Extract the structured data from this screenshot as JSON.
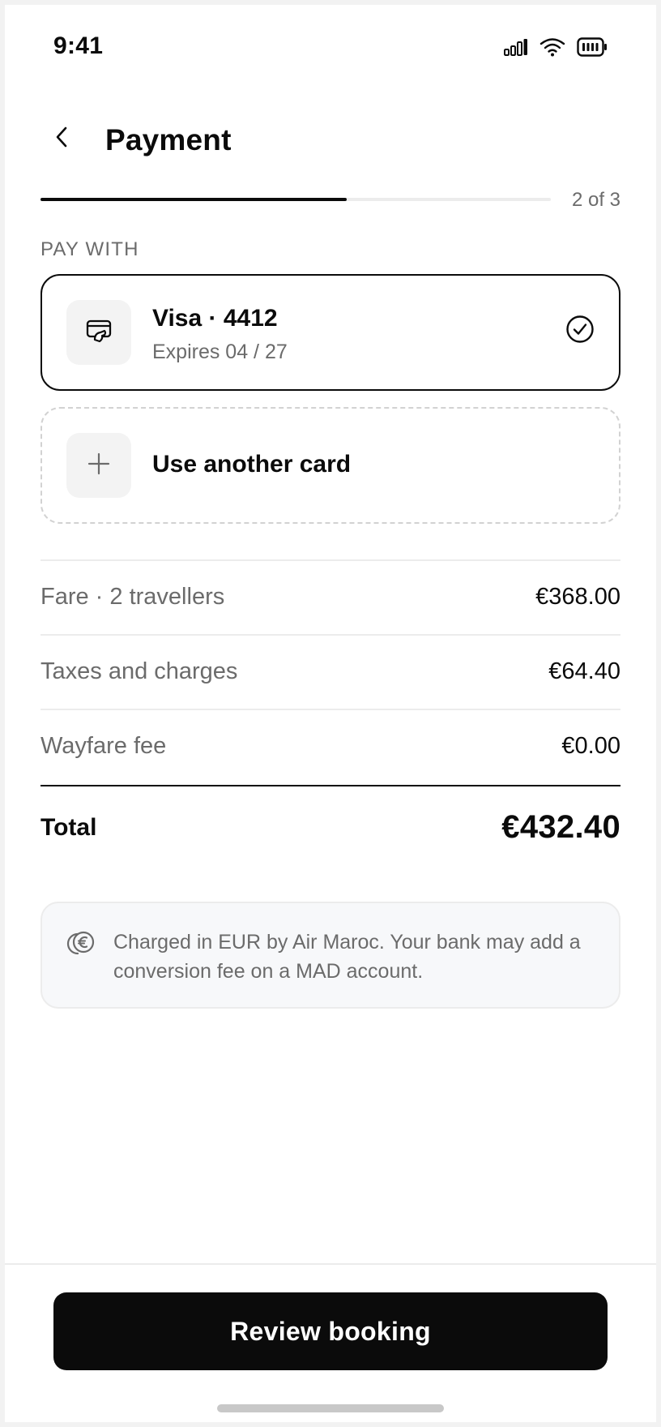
{
  "status_bar": {
    "time": "9:41",
    "icons": [
      "signal-icon",
      "wifi-icon",
      "battery-icon"
    ]
  },
  "header": {
    "back_icon": "chevron-left-icon",
    "title": "Payment"
  },
  "progress": {
    "current_step": 2,
    "total_steps": 3,
    "fraction": 0.6,
    "label": "2 of 3"
  },
  "pay_with": {
    "section_label": "PAY WITH",
    "selected_card": {
      "icon": "card-icon",
      "title": "Visa · 4412",
      "subtitle": "Expires 04 / 27",
      "status_icon": "check-circle-icon"
    },
    "add_card": {
      "icon": "plus-icon",
      "label": "Use another card"
    }
  },
  "summary": {
    "items": [
      {
        "label": "Fare · 2 travellers",
        "value": "€368.00"
      },
      {
        "label": "Taxes and charges",
        "value": "€64.40"
      },
      {
        "label": "Wayfare fee",
        "value": "€0.00"
      }
    ],
    "total_label": "Total",
    "total_value": "€432.40"
  },
  "notice": {
    "icon": "euro-coin-icon",
    "text": "Charged in EUR by Air Maroc. Your bank may add a conversion fee on a MAD account."
  },
  "footer": {
    "primary_button": "Review booking"
  },
  "colors": {
    "primary": "#0b0b0b",
    "muted_text": "#6b6b6b",
    "divider": "#ececec",
    "notice_bg": "#f7f8fa"
  }
}
